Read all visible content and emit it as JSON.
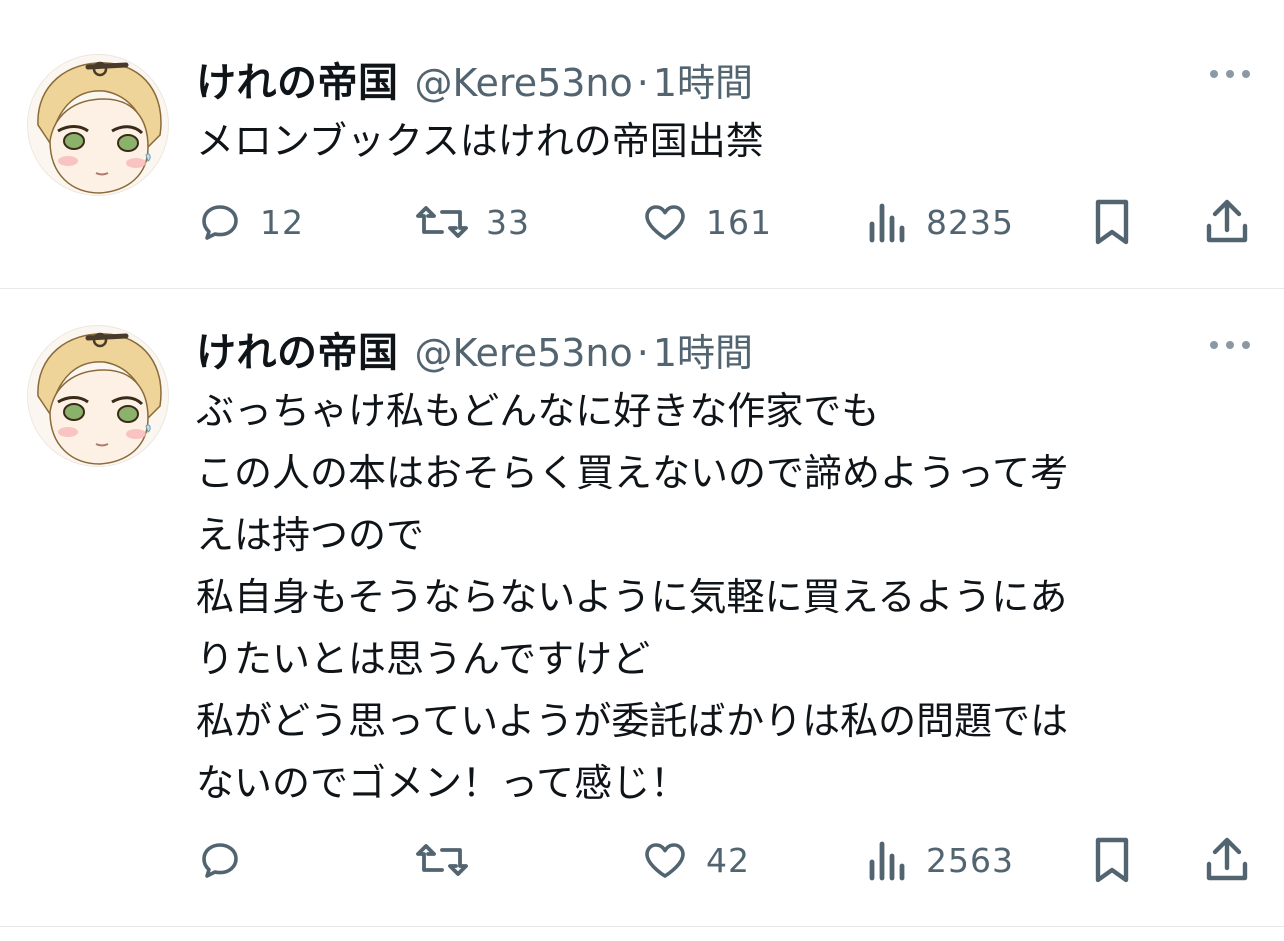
{
  "colors": {
    "text": "#0f1419",
    "secondary": "#536471",
    "divider": "#e6e8eb"
  },
  "tweets": [
    {
      "display_name": "けれの帝国",
      "handle": "@Kere53no",
      "separator": "·",
      "time": "1時間",
      "lines": [
        "メロンブックスはけれの帝国出禁"
      ],
      "replies": "12",
      "retweets": "33",
      "likes": "161",
      "views": "8235",
      "icons": [
        "more-icon",
        "reply-icon",
        "retweet-icon",
        "like-icon",
        "views-icon",
        "bookmark-icon",
        "share-icon"
      ]
    },
    {
      "display_name": "けれの帝国",
      "handle": "@Kere53no",
      "separator": "·",
      "time": "1時間",
      "lines": [
        "ぶっちゃけ私もどんなに好きな作家でも",
        "この人の本はおそらく買えないので諦めようって考",
        "えは持つので",
        "私自身もそうならないように気軽に買えるようにあ",
        "りたいとは思うんですけど",
        "私がどう思っていようが委託ばかりは私の問題では",
        "ないのでゴメン！って感じ！"
      ],
      "replies": "",
      "retweets": "",
      "likes": "42",
      "views": "2563",
      "icons": [
        "more-icon",
        "reply-icon",
        "retweet-icon",
        "like-icon",
        "views-icon",
        "bookmark-icon",
        "share-icon"
      ]
    }
  ]
}
